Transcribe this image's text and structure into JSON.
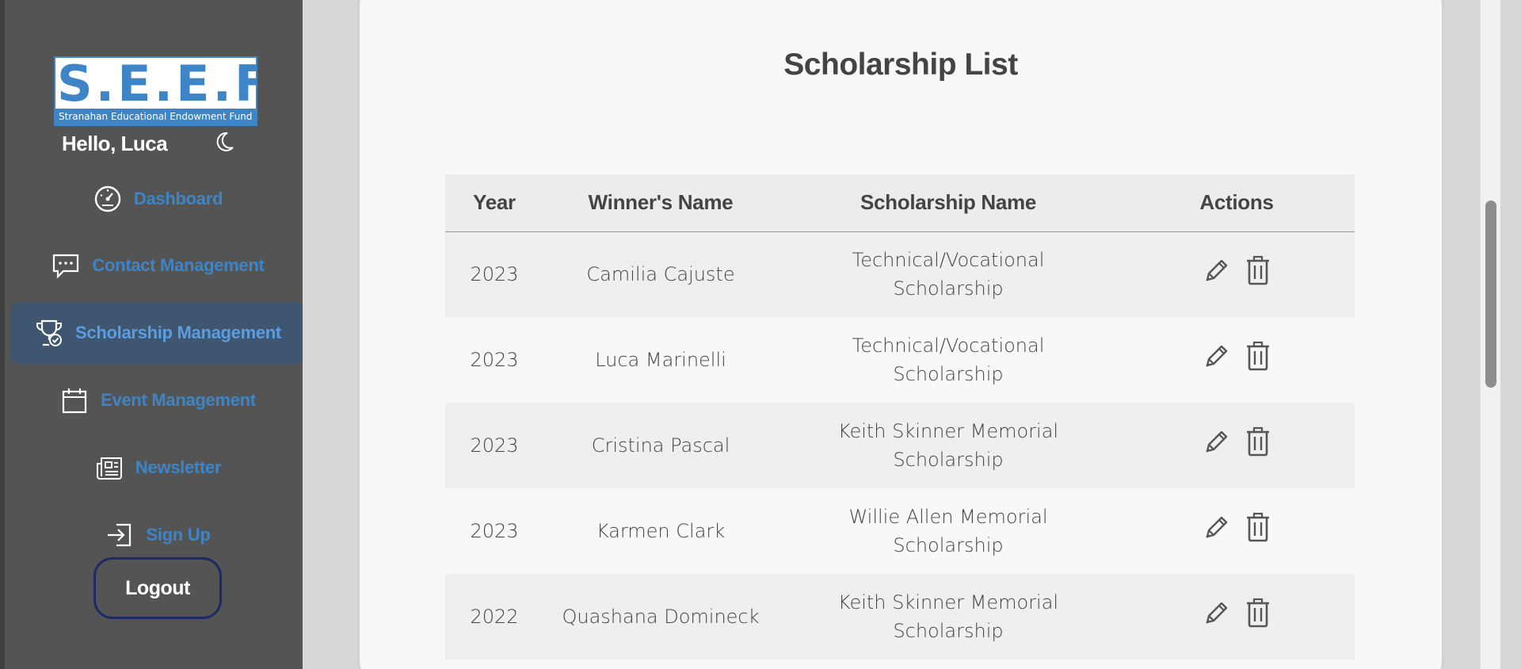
{
  "sidebar": {
    "logo": {
      "mark": "S.E.E.F.",
      "subtitle": "Stranahan Educational Endowment Fund"
    },
    "greeting": "Hello, Luca",
    "theme_icon": "moon-icon",
    "nav": [
      {
        "label": "Dashboard",
        "icon": "speedometer-icon",
        "active": false
      },
      {
        "label": "Contact Management",
        "icon": "chat-bubble-icon",
        "active": false
      },
      {
        "label": "Scholarship Management",
        "icon": "trophy-icon",
        "active": true
      },
      {
        "label": "Event Management",
        "icon": "calendar-icon",
        "active": false
      },
      {
        "label": "Newsletter",
        "icon": "newspaper-icon",
        "active": false
      },
      {
        "label": "Sign Up",
        "icon": "sign-in-icon",
        "active": false
      }
    ],
    "logout_label": "Logout"
  },
  "main": {
    "title": "Scholarship List",
    "table": {
      "headers": [
        "Year",
        "Winner's Name",
        "Scholarship Name",
        "Actions"
      ],
      "rows": [
        {
          "year": "2023",
          "winner": "Camilia Cajuste",
          "scholarship": "Technical/Vocational Scholarship"
        },
        {
          "year": "2023",
          "winner": "Luca Marinelli",
          "scholarship": "Technical/Vocational Scholarship"
        },
        {
          "year": "2023",
          "winner": "Cristina Pascal",
          "scholarship": "Keith Skinner Memorial Scholarship"
        },
        {
          "year": "2023",
          "winner": "Karmen Clark",
          "scholarship": "Willie Allen Memorial Scholarship"
        },
        {
          "year": "2022",
          "winner": "Quashana Domineck",
          "scholarship": "Keith Skinner Memorial Scholarship"
        }
      ],
      "action_icons": [
        "pencil-icon",
        "trash-icon"
      ]
    }
  },
  "colors": {
    "sidebar_bg": "#545454",
    "accent": "#3d85c6",
    "active_bg": "#3f5670",
    "logout_border": "#1c2a66",
    "card_bg": "#f8f8f8",
    "text": "#444444"
  }
}
